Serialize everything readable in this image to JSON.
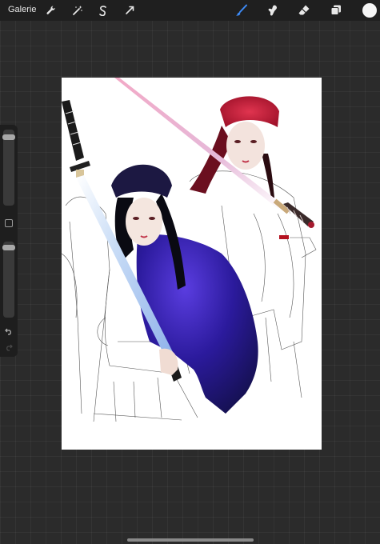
{
  "topbar": {
    "gallery_label": "Galerie",
    "left_tools": [
      "wrench-icon",
      "magic-wand-icon",
      "selection-icon",
      "transform-icon"
    ],
    "right_tools": [
      "brush-icon",
      "smudge-icon",
      "eraser-icon",
      "layers-icon"
    ],
    "active_tool": "brush",
    "accent_color": "#3d8bf7",
    "current_color": "#f5f5f5"
  },
  "sidebar": {
    "controls": [
      "brush-size-slider",
      "modify-button",
      "opacity-slider",
      "undo-icon",
      "redo-icon"
    ],
    "brush_size_level": 0.93,
    "opacity_level": 0.96
  },
  "canvas": {
    "background_color": "#ffffff",
    "artwork": "two-swordswomen-illustration"
  }
}
